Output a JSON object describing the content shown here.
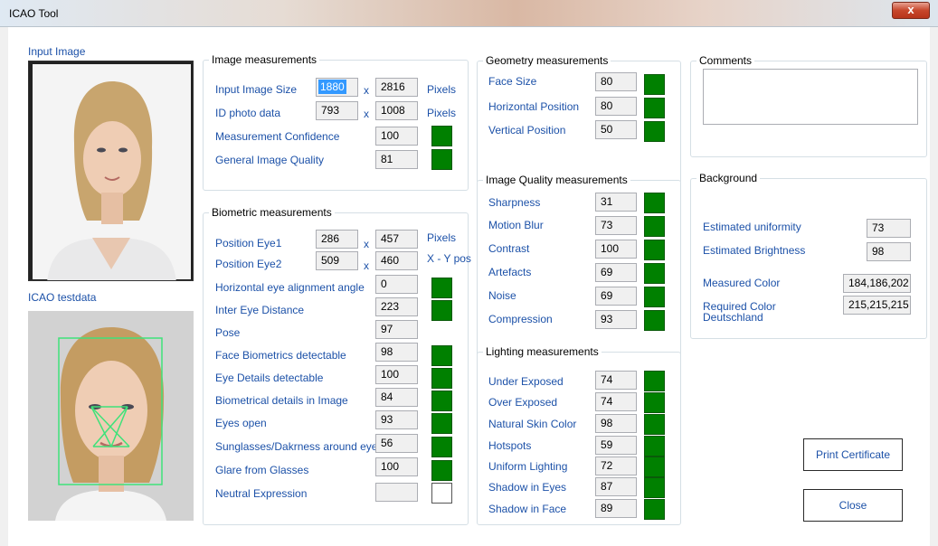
{
  "window": {
    "title": "ICAO Tool",
    "close_glyph": "x"
  },
  "left": {
    "input_image_label": "Input Image",
    "icao_testdata_label": "ICAO testdata"
  },
  "image_measurements": {
    "title": "Image measurements",
    "rows": [
      {
        "label": "Input Image Size",
        "v1": "1880",
        "sep": "x",
        "v2": "2816",
        "unit": "Pixels"
      },
      {
        "label": "ID photo data",
        "v1": "793",
        "sep": "x",
        "v2": "1008",
        "unit": "Pixels"
      },
      {
        "label": "Measurement Confidence",
        "value": "100",
        "status": "green"
      },
      {
        "label": "General Image Quality",
        "value": "81",
        "status": "green"
      }
    ]
  },
  "biometric_measurements": {
    "title": "Biometric measurements",
    "eye_rows": [
      {
        "label": "Position Eye1",
        "v1": "286",
        "sep": "x",
        "v2": "457",
        "unit": "Pixels"
      },
      {
        "label": "Position Eye2",
        "v1": "509",
        "sep": "x",
        "v2": "460",
        "unit": "X - Y pos"
      }
    ],
    "rows": [
      {
        "label": "Horizontal eye alignment angle",
        "value": "0",
        "status": "green"
      },
      {
        "label": "Inter Eye Distance",
        "value": "223",
        "status": "green"
      },
      {
        "label": "Pose",
        "value": "97",
        "status": "none"
      },
      {
        "label": "Face Biometrics detectable",
        "value": "98",
        "status": "green"
      },
      {
        "label": "Eye Details detectable",
        "value": "100",
        "status": "green"
      },
      {
        "label": "Biometrical details in Image",
        "value": "84",
        "status": "green"
      },
      {
        "label": "Eyes open",
        "value": "93",
        "status": "green"
      },
      {
        "label": "Sunglasses/Dakrness around eyes",
        "value": "56",
        "status": "green"
      },
      {
        "label": "Glare from Glasses",
        "value": "100",
        "status": "green"
      },
      {
        "label": "Neutral Expression",
        "value": "",
        "status": "empty"
      }
    ]
  },
  "geometry_measurements": {
    "title": "Geometry measurements",
    "rows": [
      {
        "label": "Face Size",
        "value": "80",
        "status": "green"
      },
      {
        "label": "Horizontal Position",
        "value": "80",
        "status": "green"
      },
      {
        "label": "Vertical Position",
        "value": "50",
        "status": "green"
      }
    ]
  },
  "image_quality_measurements": {
    "title": "Image Quality measurements",
    "rows": [
      {
        "label": "Sharpness",
        "value": "31",
        "status": "green"
      },
      {
        "label": "Motion Blur",
        "value": "73",
        "status": "green"
      },
      {
        "label": "Contrast",
        "value": "100",
        "status": "green"
      },
      {
        "label": "Artefacts",
        "value": "69",
        "status": "green"
      },
      {
        "label": "Noise",
        "value": "69",
        "status": "green"
      },
      {
        "label": "Compression",
        "value": "93",
        "status": "green"
      }
    ]
  },
  "lighting_measurements": {
    "title": "Lighting measurements",
    "rows": [
      {
        "label": "Under Exposed",
        "value": "74",
        "status": "green"
      },
      {
        "label": "Over Exposed",
        "value": "74",
        "status": "green"
      },
      {
        "label": "Natural Skin Color",
        "value": "98",
        "status": "green"
      },
      {
        "label": "Hotspots",
        "value": "59",
        "status": "green"
      },
      {
        "label": "Uniform Lighting",
        "value": "72",
        "status": "green"
      },
      {
        "label": "Shadow in Eyes",
        "value": "87",
        "status": "green"
      },
      {
        "label": "Shadow in Face",
        "value": "89",
        "status": "green"
      }
    ]
  },
  "comments": {
    "title": "Comments",
    "value": ""
  },
  "background": {
    "title": "Background",
    "rows": [
      {
        "label": "Estimated uniformity",
        "value": "73"
      },
      {
        "label": "Estimated Brightness",
        "value": "98"
      },
      {
        "label": "Measured Color",
        "value": "184,186,202"
      },
      {
        "label": "Required Color Deutschland",
        "value": "215,215,215"
      }
    ]
  },
  "buttons": {
    "print_certificate": "Print Certificate",
    "close": "Close"
  },
  "colors": {
    "ok_green": "#008000",
    "label_blue": "#1c51a8"
  }
}
